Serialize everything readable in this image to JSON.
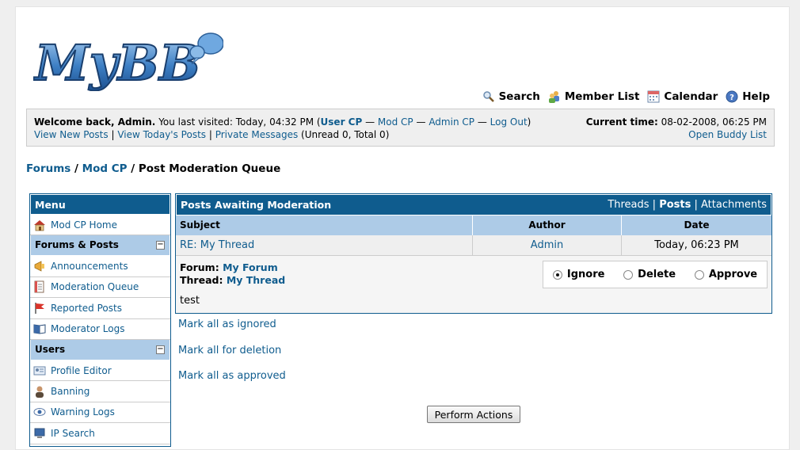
{
  "logo_text": "MyBB",
  "toplinks": [
    {
      "label": "Search",
      "icon": "magnifier-icon"
    },
    {
      "label": "Member List",
      "icon": "members-icon"
    },
    {
      "label": "Calendar",
      "icon": "calendar-icon"
    },
    {
      "label": "Help",
      "icon": "help-icon"
    }
  ],
  "welcome": {
    "greeting": "Welcome back, Admin.",
    "last_visit": "You last visited: Today, 04:32 PM (",
    "user_cp": "User CP",
    "mod_cp": "Mod CP",
    "admin_cp": "Admin CP",
    "log_out": "Log Out",
    "dash": " — ",
    "close_paren": ")",
    "current_time_label": "Current time:",
    "current_time_value": "08-02-2008, 06:25 PM",
    "view_new": "View New Posts",
    "view_today": "View Today's Posts",
    "private_messages": "Private Messages",
    "pm_counts": "(Unread 0, Total 0)",
    "pipe": " | ",
    "buddy_list": "Open Buddy List"
  },
  "breadcrumb": {
    "forums": "Forums",
    "modcp": "Mod CP",
    "current": "Post Moderation Queue",
    "sep": " / "
  },
  "sidebar": {
    "title": "Menu",
    "home": "Mod CP Home",
    "sections": [
      {
        "title": "Forums & Posts",
        "items": [
          "Announcements",
          "Moderation Queue",
          "Reported Posts",
          "Moderator Logs"
        ]
      },
      {
        "title": "Users",
        "items": [
          "Profile Editor",
          "Banning",
          "Warning Logs",
          "IP Search"
        ]
      }
    ],
    "collapse_symbol": "−"
  },
  "main": {
    "title": "Posts Awaiting Moderation",
    "tabs": {
      "threads": "Threads",
      "posts": "Posts",
      "attachments": "Attachments",
      "pipe": " | "
    },
    "columns": {
      "subject": "Subject",
      "author": "Author",
      "date": "Date"
    },
    "row": {
      "subject": "RE: My Thread",
      "author": "Admin",
      "date": "Today, 06:23 PM"
    },
    "forum_label": "Forum:",
    "forum_value": "My Forum",
    "thread_label": "Thread:",
    "thread_value": "My Thread",
    "message": "test",
    "actions": {
      "ignore": "Ignore",
      "delete": "Delete",
      "approve": "Approve",
      "selected": "ignore"
    }
  },
  "mark_links": [
    "Mark all as ignored",
    "Mark all for deletion",
    "Mark all as approved"
  ],
  "perform_button": "Perform Actions"
}
